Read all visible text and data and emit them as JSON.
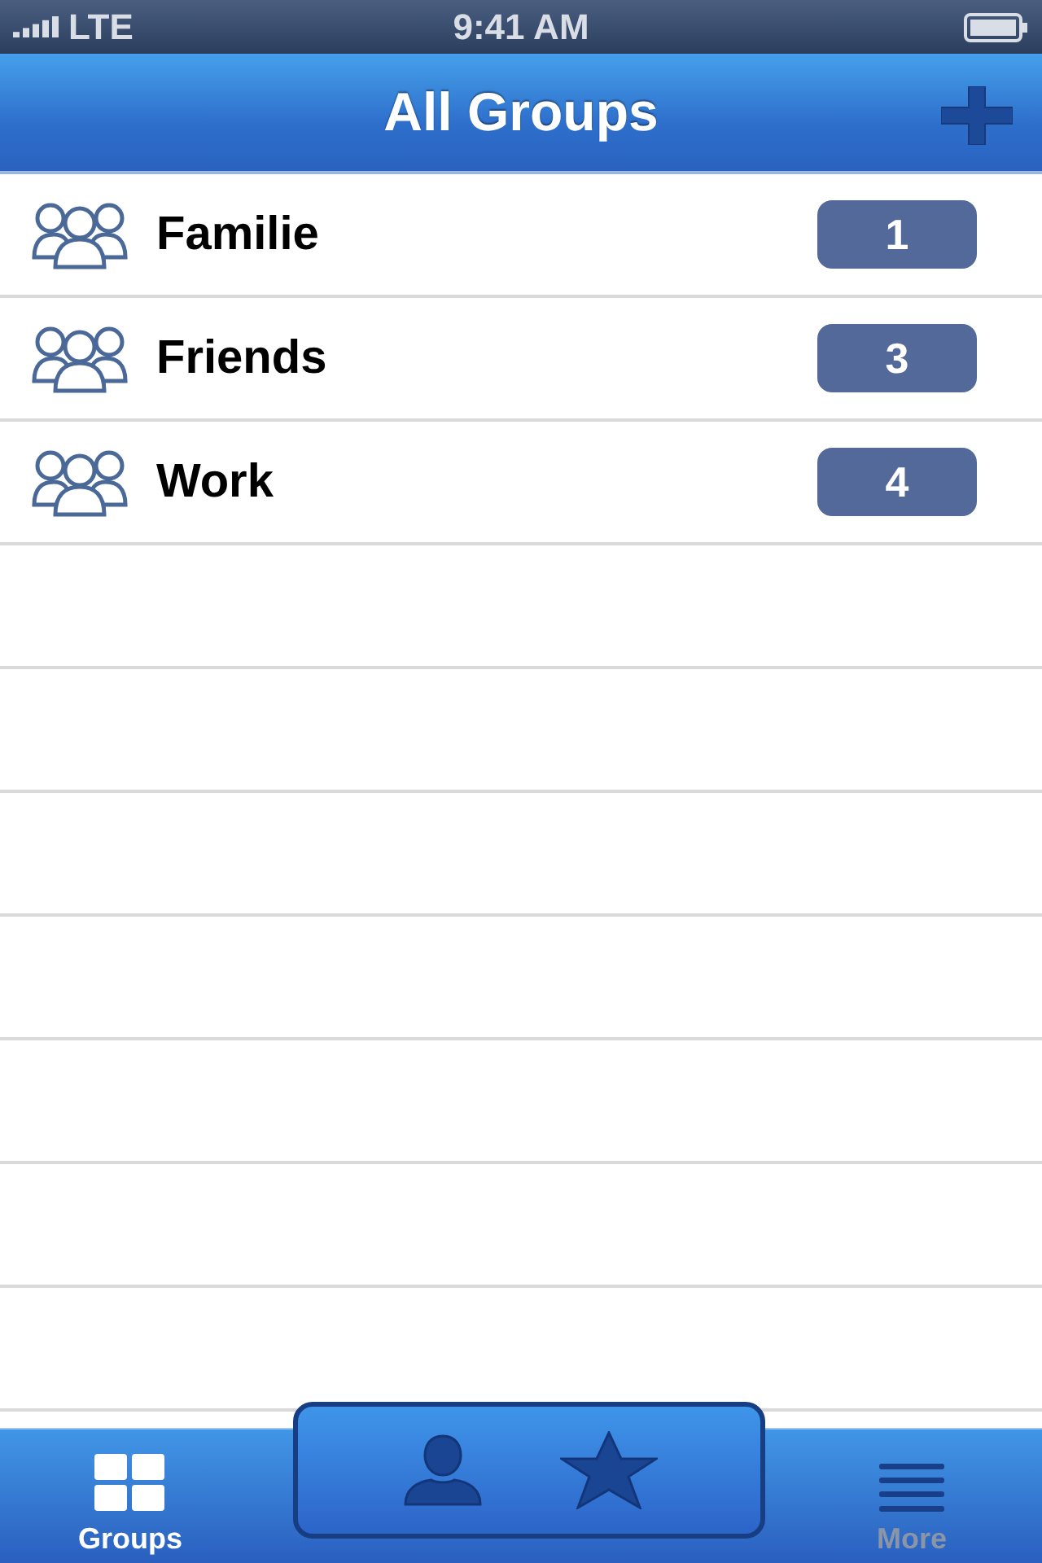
{
  "status_bar": {
    "carrier": "LTE",
    "time": "9:41 AM"
  },
  "nav_bar": {
    "title": "All Groups"
  },
  "groups": [
    {
      "name": "Familie",
      "count": "1"
    },
    {
      "name": "Friends",
      "count": "3"
    },
    {
      "name": "Work",
      "count": "4"
    }
  ],
  "tabs": [
    {
      "label": "Groups",
      "selected": true
    },
    {
      "label": "More",
      "selected": false
    }
  ]
}
